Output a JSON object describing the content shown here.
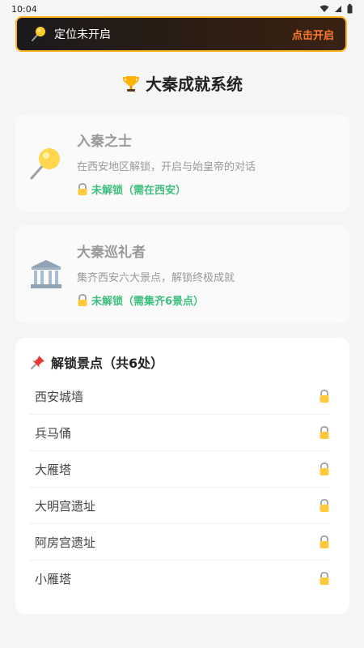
{
  "status_bar": {
    "time": "10:04"
  },
  "banner": {
    "message": "定位未开启",
    "action": "点击开启"
  },
  "page_title": "大秦成就系统",
  "achievements": [
    {
      "title": "入秦之士",
      "description": "在西安地区解锁，开启与始皇帝的对话",
      "status": "未解锁（需在西安）",
      "icon": "pin-icon"
    },
    {
      "title": "大秦巡礼者",
      "description": "集齐西安六大景点，解锁终极成就",
      "status": "未解锁（需集齐6景点）",
      "icon": "museum-icon"
    }
  ],
  "spots": {
    "heading": "解锁景点（共6处）",
    "items": [
      {
        "name": "西安城墙"
      },
      {
        "name": "兵马俑"
      },
      {
        "name": "大雁塔"
      },
      {
        "name": "大明宫遗址"
      },
      {
        "name": "阿房宫遗址"
      },
      {
        "name": "小雁塔"
      }
    ]
  },
  "colors": {
    "accent": "#ffb41f",
    "action": "#ff7a2f",
    "status": "#3fbf7f"
  }
}
